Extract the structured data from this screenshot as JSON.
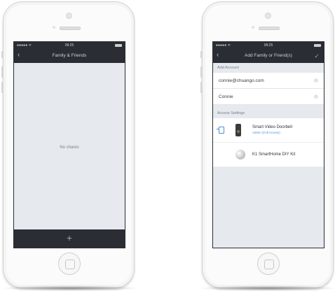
{
  "left_phone": {
    "status": {
      "signal": "●●●●● ᯤ",
      "time": "09:25"
    },
    "nav_title": "Family & Friends",
    "empty_message": "No shares",
    "add_button": "+"
  },
  "right_phone": {
    "status": {
      "signal": "●●●●● ᯤ",
      "time": "09:25"
    },
    "nav_title": "Add Family or Friend(s)",
    "add_account_header": "Add Account",
    "email_value": "connie@chuango.com",
    "name_value": "Connie",
    "access_settings_header": "Access Settings",
    "devices": [
      {
        "name": "Smart Video Doorbell",
        "subtitle": "Admin (Full Access)"
      },
      {
        "name": "K1 SmartHome DIY Kit",
        "subtitle": ""
      }
    ]
  },
  "colors": {
    "dark_bar": "#2a2d33",
    "accent": "#4b8fd8",
    "screen_bg": "#e6e9ee"
  }
}
